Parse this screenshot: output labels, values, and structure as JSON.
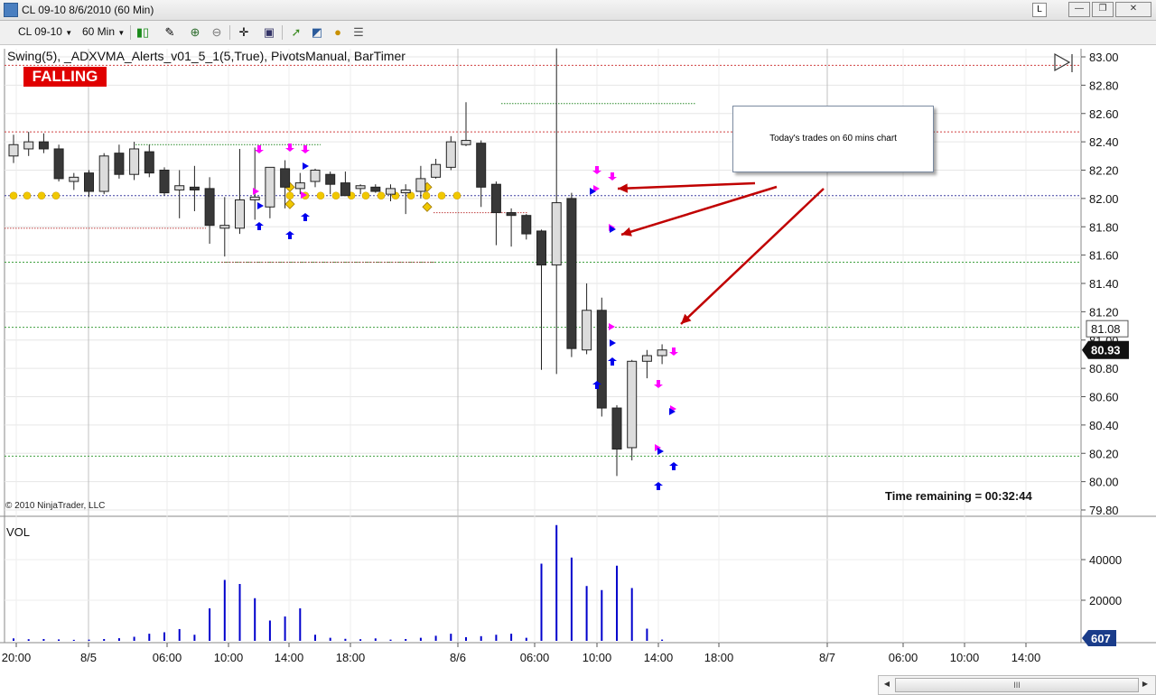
{
  "window": {
    "title": "CL 09-10  8/6/2010 (60 Min)",
    "l_button": "L",
    "min_label": "—",
    "max_label": "❐",
    "close_label": "✕"
  },
  "toolbar": {
    "instrument": "CL 09-10",
    "interval": "60 Min"
  },
  "indicators_label": "Swing(5),  _ADXVMA_Alerts_v01_5_1(5,True),  PivotsManual,  BarTimer",
  "status_badge": "FALLING",
  "copyright": "© 2010 NinjaTrader, LLC",
  "bar_timer": "Time remaining = 00:32:44",
  "callout_text": "Today's trades on 60 mins chart",
  "volume_panel": {
    "label": "VOL",
    "ticks": [
      "40000",
      "20000"
    ],
    "last_value": "607"
  },
  "scrollbar_grip": "III",
  "colors": {
    "falling_badge": "#e00000",
    "sell_arrow": "#ff00ff",
    "buy_arrow": "#0000ee",
    "adxvma_dots": "#f0c800",
    "volume_bars": "#0000cc",
    "annotation_arrows": "#c00000"
  },
  "chart_data": {
    "type": "candlestick",
    "y_axis": {
      "ticks": [
        "83.00",
        "82.80",
        "82.60",
        "82.40",
        "82.20",
        "82.00",
        "81.80",
        "81.60",
        "81.40",
        "81.20",
        "81.00",
        "80.80",
        "80.60",
        "80.40",
        "80.20",
        "80.00",
        "79.80"
      ],
      "ylim": [
        79.8,
        83.0
      ],
      "current_price": "80.93",
      "marked_price": "81.08"
    },
    "x_axis": {
      "ticks": [
        "20:00",
        "8/5",
        "06:00",
        "10:00",
        "14:00",
        "18:00",
        "8/6",
        "06:00",
        "10:00",
        "14:00",
        "18:00",
        "8/7",
        "06:00",
        "10:00",
        "14:00"
      ]
    },
    "pivot_levels": [
      82.94,
      82.47,
      82.02,
      81.55,
      81.09,
      80.18
    ],
    "candles": [
      {
        "o": 82.3,
        "h": 82.45,
        "l": 82.25,
        "c": 82.38
      },
      {
        "o": 82.35,
        "h": 82.47,
        "l": 82.3,
        "c": 82.4
      },
      {
        "o": 82.4,
        "h": 82.46,
        "l": 82.32,
        "c": 82.35
      },
      {
        "o": 82.35,
        "h": 82.38,
        "l": 82.12,
        "c": 82.14
      },
      {
        "o": 82.12,
        "h": 82.18,
        "l": 82.06,
        "c": 82.15
      },
      {
        "o": 82.18,
        "h": 82.2,
        "l": 82.01,
        "c": 82.05
      },
      {
        "o": 82.05,
        "h": 82.32,
        "l": 82.03,
        "c": 82.3
      },
      {
        "o": 82.32,
        "h": 82.38,
        "l": 82.14,
        "c": 82.17
      },
      {
        "o": 82.17,
        "h": 82.4,
        "l": 82.13,
        "c": 82.35
      },
      {
        "o": 82.33,
        "h": 82.38,
        "l": 82.15,
        "c": 82.18
      },
      {
        "o": 82.2,
        "h": 82.22,
        "l": 82.02,
        "c": 82.04
      },
      {
        "o": 82.06,
        "h": 82.2,
        "l": 81.86,
        "c": 82.09
      },
      {
        "o": 82.08,
        "h": 82.23,
        "l": 81.91,
        "c": 82.06
      },
      {
        "o": 82.07,
        "h": 82.15,
        "l": 81.68,
        "c": 81.81
      },
      {
        "o": 81.79,
        "h": 82.01,
        "l": 81.59,
        "c": 81.81
      },
      {
        "o": 81.79,
        "h": 82.35,
        "l": 81.75,
        "c": 81.99
      },
      {
        "o": 81.99,
        "h": 82.36,
        "l": 81.85,
        "c": 82.01
      },
      {
        "o": 81.94,
        "h": 82.08,
        "l": 81.86,
        "c": 82.22
      },
      {
        "o": 82.21,
        "h": 82.27,
        "l": 81.93,
        "c": 82.08
      },
      {
        "o": 82.07,
        "h": 82.18,
        "l": 82.03,
        "c": 82.11
      },
      {
        "o": 82.12,
        "h": 82.21,
        "l": 82.08,
        "c": 82.2
      },
      {
        "o": 82.17,
        "h": 82.19,
        "l": 82.03,
        "c": 82.1
      },
      {
        "o": 82.11,
        "h": 82.19,
        "l": 82.02,
        "c": 82.02
      },
      {
        "o": 82.07,
        "h": 82.1,
        "l": 82.03,
        "c": 82.09
      },
      {
        "o": 82.08,
        "h": 82.1,
        "l": 82.04,
        "c": 82.05
      },
      {
        "o": 82.03,
        "h": 82.1,
        "l": 81.98,
        "c": 82.07
      },
      {
        "o": 82.04,
        "h": 82.1,
        "l": 81.89,
        "c": 82.06
      },
      {
        "o": 82.05,
        "h": 82.23,
        "l": 82.0,
        "c": 82.14
      },
      {
        "o": 82.15,
        "h": 82.28,
        "l": 82.14,
        "c": 82.24
      },
      {
        "o": 82.22,
        "h": 82.44,
        "l": 82.2,
        "c": 82.4
      },
      {
        "o": 82.38,
        "h": 82.68,
        "l": 82.37,
        "c": 82.41
      },
      {
        "o": 82.39,
        "h": 82.41,
        "l": 81.94,
        "c": 82.08
      },
      {
        "o": 82.1,
        "h": 82.12,
        "l": 81.67,
        "c": 81.9
      },
      {
        "o": 81.9,
        "h": 81.93,
        "l": 81.66,
        "c": 81.88
      },
      {
        "o": 81.88,
        "h": 81.89,
        "l": 81.71,
        "c": 81.75
      },
      {
        "o": 81.77,
        "h": 81.78,
        "l": 80.79,
        "c": 81.53
      },
      {
        "o": 81.53,
        "h": 83.06,
        "l": 80.76,
        "c": 81.97
      },
      {
        "o": 82.0,
        "h": 82.04,
        "l": 80.88,
        "c": 80.94
      },
      {
        "o": 80.93,
        "h": 81.4,
        "l": 80.9,
        "c": 81.21
      },
      {
        "o": 81.21,
        "h": 81.3,
        "l": 80.46,
        "c": 80.52
      },
      {
        "o": 80.52,
        "h": 80.54,
        "l": 80.04,
        "c": 80.23
      },
      {
        "o": 80.24,
        "h": 80.86,
        "l": 80.15,
        "c": 80.85
      },
      {
        "o": 80.85,
        "h": 80.93,
        "l": 80.73,
        "c": 80.89
      },
      {
        "o": 80.89,
        "h": 80.97,
        "l": 80.83,
        "c": 80.93
      }
    ],
    "volume": [
      1200,
      800,
      900,
      700,
      500,
      600,
      900,
      1300,
      2000,
      3500,
      4200,
      5800,
      3000,
      16000,
      30000,
      28000,
      21000,
      10000,
      12000,
      16000,
      3000,
      1500,
      1000,
      800,
      1200,
      600,
      900,
      1500,
      2500,
      3500,
      1800,
      2300,
      3000,
      3500,
      1500,
      38000,
      57000,
      41000,
      27000,
      25000,
      37000,
      26000,
      6000,
      607
    ],
    "sell_arrows": [
      16,
      18,
      19,
      38,
      38,
      39,
      40,
      43
    ],
    "buy_arrows": [
      16,
      18,
      19,
      38,
      38,
      39,
      40,
      43
    ]
  }
}
